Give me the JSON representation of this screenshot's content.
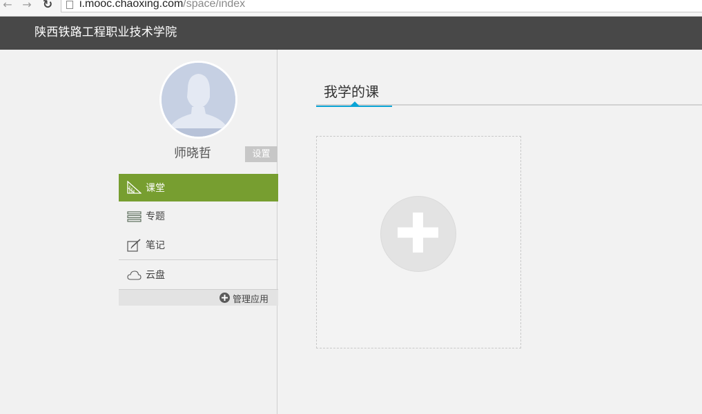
{
  "browser": {
    "url_host": "i.mooc.chaoxing.com",
    "url_path": "/space/index",
    "back_glyph": "←",
    "forward_glyph": "→",
    "reload_glyph": "↻"
  },
  "header": {
    "school_name": "陕西铁路工程职业技术学院"
  },
  "profile": {
    "name": "师晓哲",
    "settings_label": "设置"
  },
  "sidebar": {
    "items": [
      {
        "label": "课堂",
        "icon": "classroom-icon",
        "active": true
      },
      {
        "label": "专题",
        "icon": "topics-icon",
        "active": false
      },
      {
        "label": "笔记",
        "icon": "note-icon",
        "active": false
      },
      {
        "label": "云盘",
        "icon": "cloud-icon",
        "active": false
      }
    ],
    "manage_label": "管理应用"
  },
  "main": {
    "tabs": [
      {
        "label": "我学的课",
        "active": true
      }
    ]
  },
  "colors": {
    "header_bg": "#484848",
    "active_menu": "#779e30",
    "tab_accent": "#0aa4d6"
  }
}
